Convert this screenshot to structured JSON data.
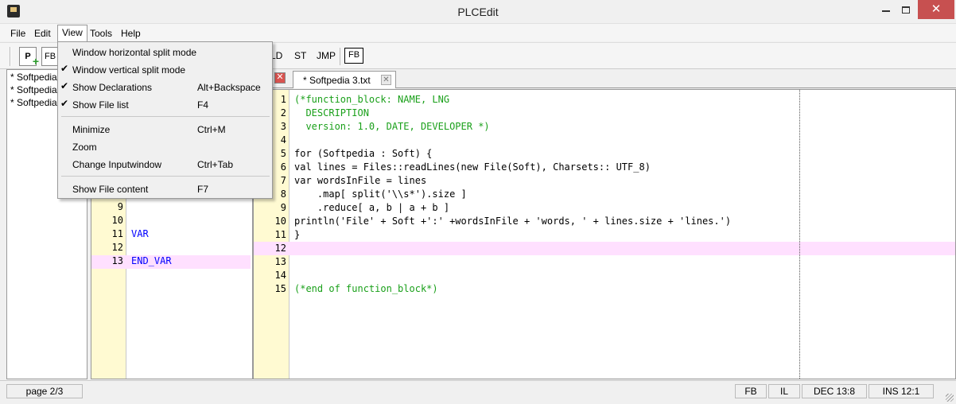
{
  "window": {
    "title": "PLCEdit"
  },
  "menubar": {
    "items": [
      "File",
      "Edit",
      "View",
      "Tools",
      "Help"
    ]
  },
  "toolbar": {
    "new_pou_label": "P",
    "fb_small_label": "FB",
    "buttons": [
      "LD",
      "ST",
      "JMP"
    ],
    "fb_label": "FB"
  },
  "view_menu": {
    "items": [
      {
        "label": "Window horizontal split mode",
        "shortcut": "",
        "checked": false
      },
      {
        "label": "Window vertical split mode",
        "shortcut": "",
        "checked": true
      },
      {
        "label": "Show Declarations",
        "shortcut": "Alt+Backspace",
        "checked": true
      },
      {
        "label": "Show File list",
        "shortcut": "F4",
        "checked": true
      },
      {
        "label": "Minimize",
        "shortcut": "Ctrl+M",
        "checked": false
      },
      {
        "label": "Zoom",
        "shortcut": "",
        "checked": false
      },
      {
        "label": "Change Inputwindow",
        "shortcut": "Ctrl+Tab",
        "checked": false
      },
      {
        "label": "Show File content",
        "shortcut": "F7",
        "checked": false
      }
    ]
  },
  "file_list": {
    "items": [
      "* Softpedia",
      "* Softpedia",
      "* Softpedia"
    ]
  },
  "declarations": {
    "lines": [
      {
        "n": "9",
        "text": ""
      },
      {
        "n": "10",
        "text": ""
      },
      {
        "n": "11",
        "text": "VAR"
      },
      {
        "n": "12",
        "text": ""
      },
      {
        "n": "13",
        "text": "END_VAR"
      }
    ],
    "highlighted_line": "13"
  },
  "tabs": {
    "active": {
      "label": "* Softpedia 3.txt"
    }
  },
  "editor": {
    "lines": [
      {
        "n": "1",
        "text": "(*function_block: NAME, LNG",
        "style": "comment"
      },
      {
        "n": "2",
        "text": "  DESCRIPTION",
        "style": "comment"
      },
      {
        "n": "3",
        "text": "  version: 1.0, DATE, DEVELOPER *)",
        "style": "comment"
      },
      {
        "n": "4",
        "text": "",
        "style": "normal"
      },
      {
        "n": "5",
        "text": "for (Softpedia : Soft) {",
        "style": "normal"
      },
      {
        "n": "6",
        "text": "val lines = Files::readLines(new File(Soft), Charsets:: UTF_8)",
        "style": "normal"
      },
      {
        "n": "7",
        "text": "var wordsInFile = lines",
        "style": "normal"
      },
      {
        "n": "8",
        "text": "    .map[ split('\\\\s*').size ]",
        "style": "normal"
      },
      {
        "n": "9",
        "text": "    .reduce[ a, b | a + b ]",
        "style": "normal"
      },
      {
        "n": "10",
        "text": "println('File' + Soft +':' +wordsInFile + 'words, ' + lines.size + 'lines.')",
        "style": "normal"
      },
      {
        "n": "11",
        "text": "}",
        "style": "normal"
      },
      {
        "n": "12",
        "text": "",
        "style": "normal"
      },
      {
        "n": "13",
        "text": "",
        "style": "normal"
      },
      {
        "n": "14",
        "text": "",
        "style": "normal"
      },
      {
        "n": "15",
        "text": "(*end of function_block*)",
        "style": "comment"
      }
    ],
    "highlighted_line": "12"
  },
  "statusbar": {
    "page": "page 2/3",
    "type": "FB",
    "language": "IL",
    "cursor": "DEC 13:8",
    "mode": "INS 12:1"
  }
}
